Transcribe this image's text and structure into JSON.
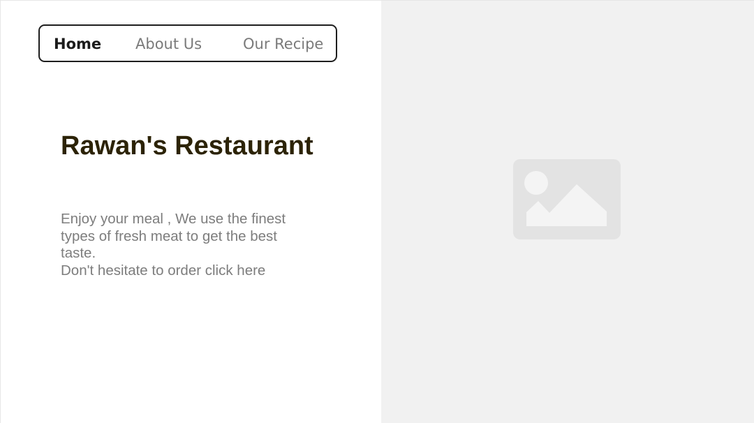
{
  "nav": {
    "items": [
      {
        "label": "Home",
        "active": true
      },
      {
        "label": "About Us",
        "active": false
      },
      {
        "label": "Our Recipe",
        "active": false
      }
    ]
  },
  "hero": {
    "title": "Rawan's Restaurant",
    "description": "Enjoy your meal , We use the finest types of fresh meat to get the best taste.",
    "cta": "Don't hesitate to order click here"
  },
  "image": {
    "icon": "image-placeholder-icon"
  },
  "colors": {
    "title": "#2c2306",
    "text": "#7d7d7d",
    "nav_active": "#1b1b1b",
    "nav_inactive": "#7a7a7a",
    "image_panel_bg": "#f1f1f1",
    "image_icon": "#e3e3e3"
  }
}
